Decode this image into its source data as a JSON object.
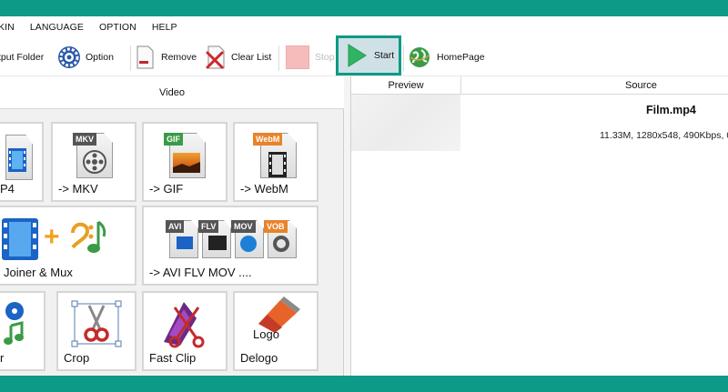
{
  "menu": [
    "KIN",
    "LANGUAGE",
    "OPTION",
    "HELP"
  ],
  "toolbar": {
    "output_folder": "tput Folder",
    "option": "Option",
    "remove": "Remove",
    "clear_list": "Clear List",
    "stop": "Stop",
    "start": "Start",
    "homepage": "HomePage"
  },
  "left": {
    "header": "Video",
    "tiles": {
      "mp4": "P4",
      "mkv": "-> MKV",
      "gif": "-> GIF",
      "webm": "-> WebM",
      "joiner": "Joiner & Mux",
      "multi": "-> AVI FLV MOV ....",
      "extract": "r",
      "crop": "Crop",
      "fastclip": "Fast Clip",
      "delogo": "Delogo"
    },
    "badges": {
      "mkv": "MKV",
      "gif": "GIF",
      "webm": "WebM",
      "avi": "AVI",
      "flv": "FLV",
      "mov": "MOV",
      "vob": "VOB",
      "logo": "Logo"
    }
  },
  "right": {
    "columns": {
      "preview": "Preview",
      "source": "Source"
    },
    "file": {
      "name": "Film.mp4",
      "info": "11.33M, 1280x548, 490Kbps, 0"
    }
  },
  "colors": {
    "accent": "#0d9a86",
    "start_green": "#2fb463",
    "badge_orange": "#e8832a",
    "badge_green": "#3a9b46"
  }
}
